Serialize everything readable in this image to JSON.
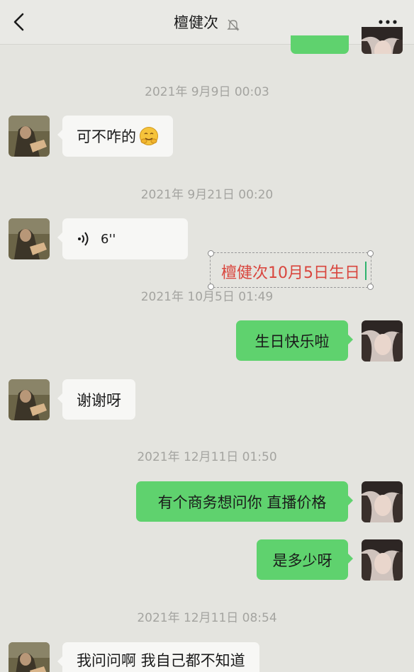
{
  "header": {
    "title": "檀健次",
    "back_icon": "chevron-left-icon",
    "mute_icon": "bell-off-icon",
    "more_icon": "more-dots-icon"
  },
  "colors": {
    "background": "#e4e4df",
    "outgoing_bubble": "#5fd26e",
    "incoming_bubble": "#f7f7f5",
    "timestamp": "#a4a4a0",
    "overlay_text": "#d9463e"
  },
  "messages": [
    {
      "type": "timestamp",
      "text": "2021年 9月9日 00:03"
    },
    {
      "type": "incoming",
      "text": "可不咋的",
      "emoji": "hugging-face-icon"
    },
    {
      "type": "timestamp",
      "text": "2021年 9月21日 00:20"
    },
    {
      "type": "incoming-voice",
      "text": "6''",
      "icon": "voice-wave-icon"
    },
    {
      "type": "timestamp",
      "text": "2021年 10月5日 01:49"
    },
    {
      "type": "outgoing",
      "text": "生日快乐啦"
    },
    {
      "type": "incoming",
      "text": "谢谢呀"
    },
    {
      "type": "timestamp",
      "text": "2021年 12月11日 01:50"
    },
    {
      "type": "outgoing",
      "text": "有个商务想问你 直播价格"
    },
    {
      "type": "outgoing",
      "text": "是多少呀"
    },
    {
      "type": "timestamp",
      "text": "2021年 12月11日 08:54"
    },
    {
      "type": "incoming",
      "text": "我问问啊 我自己都不知道"
    }
  ],
  "overlay": {
    "text": "檀健次10月5日生日"
  }
}
